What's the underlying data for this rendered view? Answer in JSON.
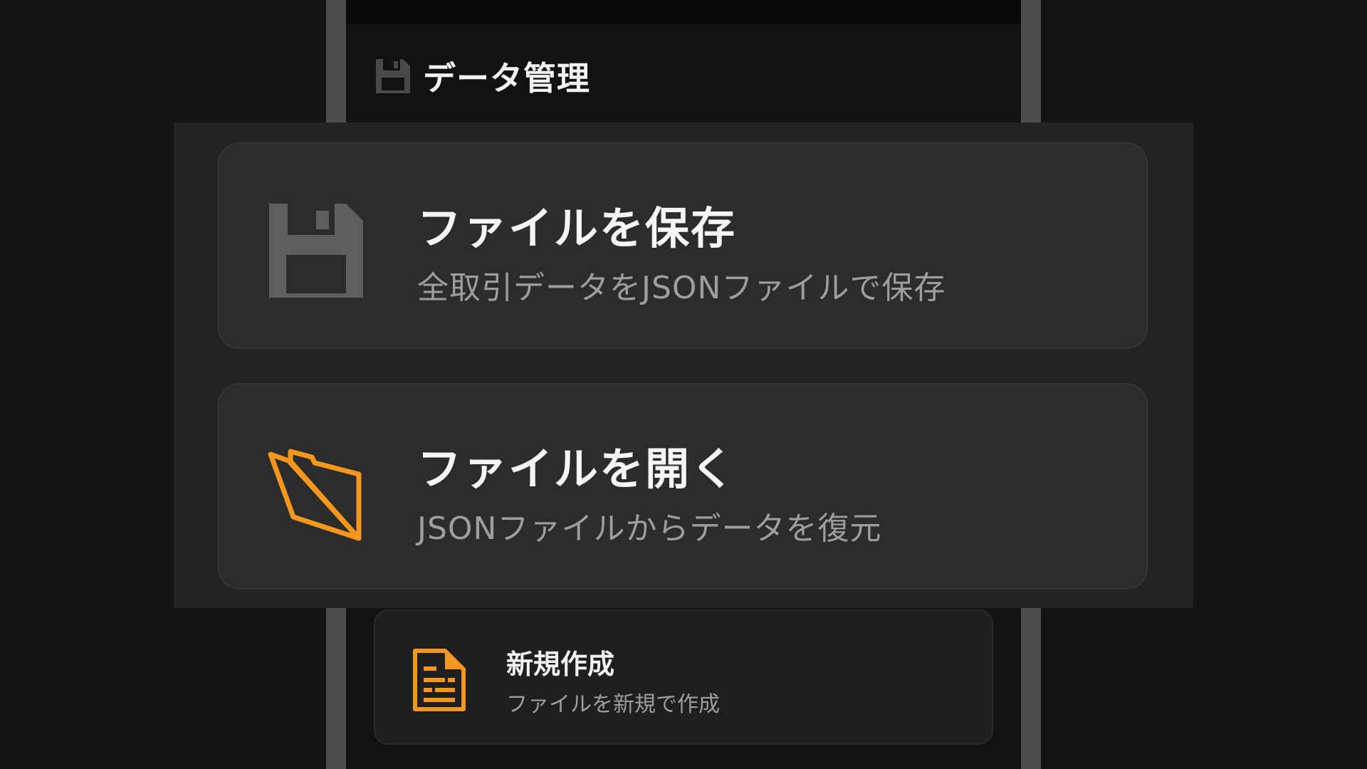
{
  "header": {
    "icon": "floppy-disk-icon",
    "title": "データ管理"
  },
  "actions": [
    {
      "icon": "floppy-disk-icon",
      "title": "ファイルを保存",
      "description": "全取引データをJSONファイルで保存"
    },
    {
      "icon": "open-folder-icon",
      "title": "ファイルを開く",
      "description": "JSONファイルからデータを復元"
    },
    {
      "icon": "document-icon",
      "title": "新規作成",
      "description": "ファイルを新規で作成"
    }
  ],
  "colors": {
    "accent": "#f5961d",
    "icon_gray": "#5e5e5e",
    "background": "#141414",
    "card": "#2c2c2c"
  }
}
